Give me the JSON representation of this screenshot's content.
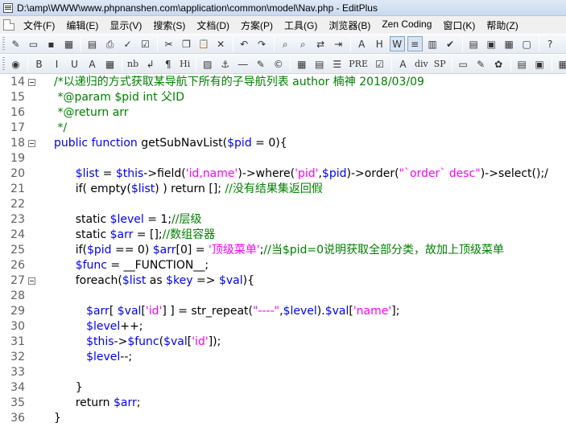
{
  "window": {
    "title": "D:\\amp\\WWW\\www.phpnanshen.com\\application\\common\\model\\Nav.php - EditPlus"
  },
  "menu": {
    "items": [
      {
        "label": "文件(F)"
      },
      {
        "label": "编辑(E)"
      },
      {
        "label": "显示(V)"
      },
      {
        "label": "搜索(S)"
      },
      {
        "label": "文档(D)"
      },
      {
        "label": "方案(P)"
      },
      {
        "label": "工具(G)"
      },
      {
        "label": "浏览器(B)"
      },
      {
        "label": "Zen Coding"
      },
      {
        "label": "窗口(K)"
      },
      {
        "label": "帮助(Z)"
      }
    ]
  },
  "toolbar1": {
    "buttons": [
      {
        "name": "new-file-icon",
        "glyph": "✎"
      },
      {
        "name": "open-file-icon",
        "glyph": "▭"
      },
      {
        "name": "save-icon",
        "glyph": "▪"
      },
      {
        "name": "save-all-icon",
        "glyph": "▦"
      },
      {
        "sep": true
      },
      {
        "name": "print-preview-icon",
        "glyph": "▤"
      },
      {
        "name": "print-icon",
        "glyph": "⎙"
      },
      {
        "name": "spellcheck-icon",
        "glyph": "✓"
      },
      {
        "name": "spellcheck-all-icon",
        "glyph": "☑"
      },
      {
        "sep": true
      },
      {
        "name": "cut-icon",
        "glyph": "✂"
      },
      {
        "name": "copy-icon",
        "glyph": "❐"
      },
      {
        "name": "paste-icon",
        "glyph": "📋"
      },
      {
        "name": "delete-icon",
        "glyph": "✕"
      },
      {
        "sep": true
      },
      {
        "name": "undo-icon",
        "glyph": "↶"
      },
      {
        "name": "redo-icon",
        "glyph": "↷"
      },
      {
        "sep": true
      },
      {
        "name": "find-icon",
        "glyph": "⌕"
      },
      {
        "name": "find-in-files-icon",
        "glyph": "⌕"
      },
      {
        "name": "replace-icon",
        "glyph": "⇄"
      },
      {
        "name": "goto-line-icon",
        "glyph": "⇥"
      },
      {
        "sep": true
      },
      {
        "name": "font-icon",
        "glyph": "A"
      },
      {
        "name": "heading-icon",
        "glyph": "H"
      },
      {
        "name": "word-wrap-icon",
        "glyph": "W",
        "pressed": true
      },
      {
        "name": "line-number-icon",
        "glyph": "≡",
        "pressed": true
      },
      {
        "name": "column-ruler-icon",
        "glyph": "▥"
      },
      {
        "name": "check-icon",
        "glyph": "✔"
      },
      {
        "sep": true
      },
      {
        "name": "window-list-icon",
        "glyph": "▤"
      },
      {
        "name": "clip-library-icon",
        "glyph": "▣"
      },
      {
        "name": "directory-icon",
        "glyph": "▦"
      },
      {
        "name": "output-window-icon",
        "glyph": "▢"
      },
      {
        "sep": true
      },
      {
        "name": "help-icon",
        "glyph": "?"
      }
    ]
  },
  "toolbar2": {
    "buttons": [
      {
        "name": "browser-icon",
        "glyph": "◉"
      },
      {
        "sep": true
      },
      {
        "name": "bold-icon",
        "glyph": "B"
      },
      {
        "name": "italic-icon",
        "glyph": "I"
      },
      {
        "name": "underline-icon",
        "glyph": "U"
      },
      {
        "name": "font-color-icon",
        "glyph": "A"
      },
      {
        "name": "color-picker-icon",
        "glyph": "▦"
      },
      {
        "sep": true
      },
      {
        "name": "nbsp-icon",
        "glyph": "nb"
      },
      {
        "name": "line-break-icon",
        "glyph": "↲"
      },
      {
        "name": "paragraph-icon",
        "glyph": "¶"
      },
      {
        "name": "heading-tag-icon",
        "glyph": "Hi"
      },
      {
        "sep": true
      },
      {
        "name": "image-icon",
        "glyph": "▨"
      },
      {
        "name": "anchor-icon",
        "glyph": "⚓"
      },
      {
        "name": "horizontal-rule-icon",
        "glyph": "―"
      },
      {
        "name": "comment-icon",
        "glyph": "✎"
      },
      {
        "name": "copyright-icon",
        "glyph": "©"
      },
      {
        "sep": true
      },
      {
        "name": "table-icon",
        "glyph": "▦"
      },
      {
        "name": "form-icon",
        "glyph": "▤"
      },
      {
        "name": "list-icon",
        "glyph": "☰"
      },
      {
        "name": "pre-icon",
        "glyph": "PRE"
      },
      {
        "name": "checkbox-icon",
        "glyph": "☑"
      },
      {
        "sep": true
      },
      {
        "name": "font-tag-icon",
        "glyph": "A"
      },
      {
        "name": "div-icon",
        "glyph": "div"
      },
      {
        "name": "span-icon",
        "glyph": "SP"
      },
      {
        "sep": true
      },
      {
        "name": "style-icon",
        "glyph": "▭"
      },
      {
        "name": "css-icon",
        "glyph": "✎"
      },
      {
        "name": "script-icon",
        "glyph": "✿"
      },
      {
        "sep": true
      },
      {
        "name": "html-toolbar-icon",
        "glyph": "▤"
      },
      {
        "name": "html-preview-icon",
        "glyph": "▣"
      },
      {
        "sep": true
      },
      {
        "name": "palette-icon",
        "glyph": "▦"
      }
    ]
  },
  "editor": {
    "lines": [
      {
        "num": "14",
        "fold": true,
        "segments": [
          {
            "t": "/*以递归的方式获取某导航下所有的子导航列表 author 楠神 2018/03/09",
            "c": "comment"
          }
        ]
      },
      {
        "num": "15",
        "segments": [
          {
            "t": " *@param $pid int 父ID",
            "c": "comment"
          }
        ]
      },
      {
        "num": "16",
        "segments": [
          {
            "t": " *@return arr",
            "c": "comment"
          }
        ]
      },
      {
        "num": "17",
        "segments": [
          {
            "t": " */",
            "c": "comment"
          }
        ]
      },
      {
        "num": "18",
        "fold": true,
        "segments": [
          {
            "t": "public function ",
            "c": "kw"
          },
          {
            "t": "getSubNavList(",
            "c": "plain"
          },
          {
            "t": "$pid",
            "c": "var"
          },
          {
            "t": " = 0){",
            "c": "plain"
          }
        ]
      },
      {
        "num": "19",
        "segments": []
      },
      {
        "num": "20",
        "segments": [
          {
            "t": "      ",
            "c": "plain"
          },
          {
            "t": "$list",
            "c": "var"
          },
          {
            "t": " = ",
            "c": "plain"
          },
          {
            "t": "$this",
            "c": "var"
          },
          {
            "t": "->field(",
            "c": "plain"
          },
          {
            "t": "'id,name'",
            "c": "str"
          },
          {
            "t": ")->where(",
            "c": "plain"
          },
          {
            "t": "'pid'",
            "c": "str"
          },
          {
            "t": ",",
            "c": "plain"
          },
          {
            "t": "$pid",
            "c": "var"
          },
          {
            "t": ")->order(",
            "c": "plain"
          },
          {
            "t": "\"`order` desc\"",
            "c": "str"
          },
          {
            "t": ")->select();/",
            "c": "plain"
          }
        ]
      },
      {
        "num": "21",
        "segments": [
          {
            "t": "      if( empty(",
            "c": "plain"
          },
          {
            "t": "$list",
            "c": "var"
          },
          {
            "t": ") ) return []; ",
            "c": "plain"
          },
          {
            "t": "//没有结果集返回假",
            "c": "comment"
          }
        ]
      },
      {
        "num": "22",
        "segments": []
      },
      {
        "num": "23",
        "segments": [
          {
            "t": "      static ",
            "c": "plain"
          },
          {
            "t": "$level",
            "c": "var"
          },
          {
            "t": " = 1;",
            "c": "plain"
          },
          {
            "t": "//层级",
            "c": "comment"
          }
        ]
      },
      {
        "num": "24",
        "segments": [
          {
            "t": "      static ",
            "c": "plain"
          },
          {
            "t": "$arr",
            "c": "var"
          },
          {
            "t": " = [];",
            "c": "plain"
          },
          {
            "t": "//数组容器",
            "c": "comment"
          }
        ]
      },
      {
        "num": "25",
        "segments": [
          {
            "t": "      if(",
            "c": "plain"
          },
          {
            "t": "$pid",
            "c": "var"
          },
          {
            "t": " == 0) ",
            "c": "plain"
          },
          {
            "t": "$arr",
            "c": "var"
          },
          {
            "t": "[0] = ",
            "c": "plain"
          },
          {
            "t": "'顶级菜单'",
            "c": "str"
          },
          {
            "t": ";",
            "c": "plain"
          },
          {
            "t": "//当$pid=0说明获取全部分类，故加上顶级菜单",
            "c": "comment"
          }
        ]
      },
      {
        "num": "26",
        "segments": [
          {
            "t": "      ",
            "c": "plain"
          },
          {
            "t": "$func",
            "c": "var"
          },
          {
            "t": " = __FUNCTION__;",
            "c": "plain"
          }
        ]
      },
      {
        "num": "27",
        "fold": true,
        "segments": [
          {
            "t": "      foreach(",
            "c": "plain"
          },
          {
            "t": "$list",
            "c": "var"
          },
          {
            "t": " as ",
            "c": "plain"
          },
          {
            "t": "$key",
            "c": "var"
          },
          {
            "t": " => ",
            "c": "plain"
          },
          {
            "t": "$val",
            "c": "var"
          },
          {
            "t": "){",
            "c": "plain"
          }
        ]
      },
      {
        "num": "28",
        "segments": []
      },
      {
        "num": "29",
        "segments": [
          {
            "t": "         ",
            "c": "plain"
          },
          {
            "t": "$arr",
            "c": "var"
          },
          {
            "t": "[ ",
            "c": "plain"
          },
          {
            "t": "$val",
            "c": "var"
          },
          {
            "t": "[",
            "c": "plain"
          },
          {
            "t": "'id'",
            "c": "str"
          },
          {
            "t": "] ] = str_repeat(",
            "c": "plain"
          },
          {
            "t": "\"----\"",
            "c": "str"
          },
          {
            "t": ",",
            "c": "plain"
          },
          {
            "t": "$level",
            "c": "var"
          },
          {
            "t": ").",
            "c": "plain"
          },
          {
            "t": "$val",
            "c": "var"
          },
          {
            "t": "[",
            "c": "plain"
          },
          {
            "t": "'name'",
            "c": "str"
          },
          {
            "t": "];",
            "c": "plain"
          }
        ]
      },
      {
        "num": "30",
        "segments": [
          {
            "t": "         ",
            "c": "plain"
          },
          {
            "t": "$level",
            "c": "var"
          },
          {
            "t": "++;",
            "c": "plain"
          }
        ]
      },
      {
        "num": "31",
        "segments": [
          {
            "t": "         ",
            "c": "plain"
          },
          {
            "t": "$this",
            "c": "var"
          },
          {
            "t": "->",
            "c": "plain"
          },
          {
            "t": "$func",
            "c": "var"
          },
          {
            "t": "(",
            "c": "plain"
          },
          {
            "t": "$val",
            "c": "var"
          },
          {
            "t": "[",
            "c": "plain"
          },
          {
            "t": "'id'",
            "c": "str"
          },
          {
            "t": "]);",
            "c": "plain"
          }
        ]
      },
      {
        "num": "32",
        "segments": [
          {
            "t": "         ",
            "c": "plain"
          },
          {
            "t": "$level",
            "c": "var"
          },
          {
            "t": "--;",
            "c": "plain"
          }
        ]
      },
      {
        "num": "33",
        "segments": []
      },
      {
        "num": "34",
        "segments": [
          {
            "t": "      }",
            "c": "plain"
          }
        ]
      },
      {
        "num": "35",
        "segments": [
          {
            "t": "      return ",
            "c": "plain"
          },
          {
            "t": "$arr",
            "c": "var"
          },
          {
            "t": ";",
            "c": "plain"
          }
        ]
      },
      {
        "num": "36",
        "segments": [
          {
            "t": "}",
            "c": "plain"
          }
        ]
      }
    ]
  },
  "colors": {
    "comment": "#008000",
    "keyword": "#0000ff",
    "variable": "#0000ff",
    "string": "#ff00ff",
    "line_number": "#606060"
  }
}
